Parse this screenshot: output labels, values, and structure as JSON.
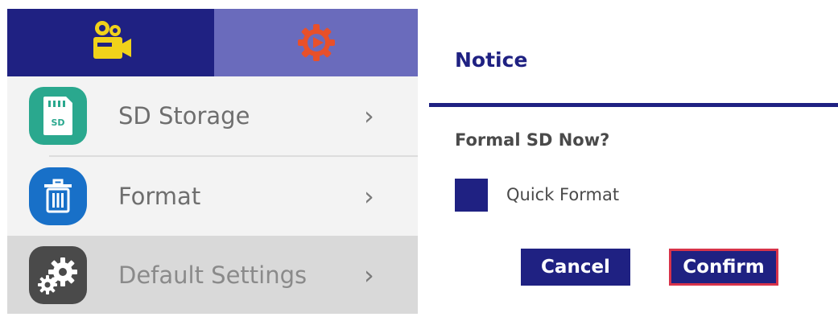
{
  "tabs": {
    "video_icon": "video-camera-icon",
    "settings_icon": "settings-gear-icon",
    "active_color": "#1f2182",
    "inactive_color": "#6a6bbc",
    "video_icon_color": "#f0d21a",
    "settings_icon_color": "#e8502a"
  },
  "menu": {
    "items": [
      {
        "label": "SD Storage",
        "icon": "sd-card-icon",
        "icon_color": "#2aa88e",
        "icon_text": "SD"
      },
      {
        "label": "Format",
        "icon": "trash-icon",
        "icon_color": "#1870c8"
      },
      {
        "label": "Default Settings",
        "icon": "gears-icon",
        "icon_color": "#4a4a4a"
      }
    ],
    "chevron": "›"
  },
  "dialog": {
    "title": "Notice",
    "question": "Formal SD Now?",
    "checkbox_label": "Quick Format",
    "cancel_label": "Cancel",
    "confirm_label": "Confirm",
    "accent": "#1f2182",
    "focus_border": "#d8334a"
  }
}
